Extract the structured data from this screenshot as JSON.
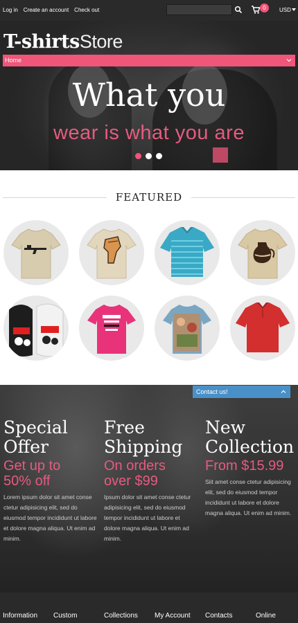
{
  "topbar": {
    "links": [
      "Log in",
      "Create an account",
      "Check out"
    ],
    "search_placeholder": "",
    "cart_count": "0",
    "currency": "USD"
  },
  "header": {
    "logo_bold": "T-shirts",
    "logo_light": "Store",
    "nav_label": "Home"
  },
  "hero": {
    "title": "What you",
    "subtitle": "wear is what you are",
    "slides": 3,
    "active_slide": 1
  },
  "featured": {
    "title": "FEATURED",
    "products": [
      {
        "icon": "tshirt-rifle-icon",
        "color": "#d8ccae"
      },
      {
        "icon": "tshirt-fist-icon",
        "color": "#e2d7bd"
      },
      {
        "icon": "polo-striped-icon",
        "color": "#3aa9c5"
      },
      {
        "icon": "tshirt-coffee-pot-icon",
        "color": "#d9c8a4"
      },
      {
        "icon": "socks-dope-icon",
        "color": "#1d1d1d"
      },
      {
        "icon": "tshirt-pink-print-icon",
        "color": "#e8337a"
      },
      {
        "icon": "tshirt-photo-print-icon",
        "color": "#7aa6c2"
      },
      {
        "icon": "polo-red-icon",
        "color": "#d32f2f"
      }
    ]
  },
  "contact": {
    "label": "Contact us!"
  },
  "promos": [
    {
      "heading_1": "Special",
      "heading_2": "Offer",
      "sub_1": "Get up to",
      "sub_2": "50% off",
      "body": "Lorem ipsum dolor sit amet conse ctetur adipisicing elit, sed do eiusmod tempor incididunt ut labore et dolore magna aliqua. Ut enim ad minim."
    },
    {
      "heading_1": "Free",
      "heading_2": "Shipping",
      "sub_1": "On orders",
      "sub_2": "over $99",
      "body": "Ipsum dolor sit amet conse ctetur adipisicing elit, sed do eiusmod tempor incididunt ut labore et dolore magna aliqua. Ut enim ad minim."
    },
    {
      "heading_1": "New",
      "heading_2": "Collection",
      "sub_1": "From $15.99",
      "sub_2": "",
      "body": "Siit amet conse ctetur adipisicing elit, sed do eiusmod tempor incididunt ut labore et dolore magna aliqua. Ut enim ad minim."
    }
  ],
  "footer": {
    "columns": [
      "Information",
      "Custom",
      "Collections",
      "My Account",
      "Contacts",
      "Online"
    ]
  },
  "colors": {
    "accent": "#f0557a",
    "dark": "#2a2a2a",
    "contact_blue": "#4a90c8"
  }
}
